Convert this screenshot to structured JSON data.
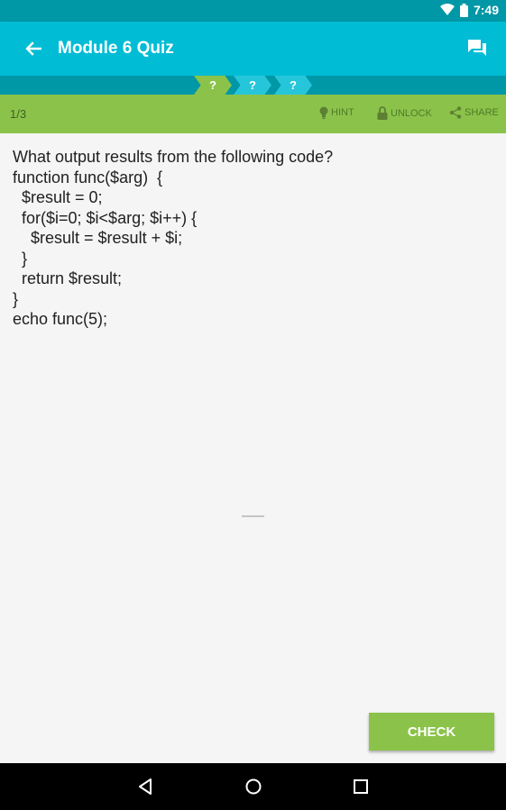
{
  "status_bar": {
    "time": "7:49",
    "icons": [
      "wifi-icon",
      "battery-icon"
    ]
  },
  "app_bar": {
    "title": "Module 6 Quiz",
    "back_icon": "arrow-back-icon",
    "chat_icon": "chat-icon"
  },
  "progress": {
    "steps": [
      "?",
      "?",
      "?"
    ],
    "active_index": 0
  },
  "quiz_bar": {
    "counter": "1/3",
    "hint_label": "HINT",
    "unlock_label": "UNLOCK",
    "share_label": "SHARE"
  },
  "question": {
    "prompt": "What output results from the following code?",
    "code_lines": [
      "function func($arg)  {",
      "  $result = 0;",
      "  for($i=0; $i<$arg; $i++) {",
      "    $result = $result + $i;",
      "  }",
      "  return $result;",
      "}",
      "echo func(5);"
    ]
  },
  "check_button": {
    "label": "CHECK"
  },
  "colors": {
    "primary": "#00bcd4",
    "primary_dark": "#0097a7",
    "accent_green": "#8bc34a",
    "step_pending": "#26c6da"
  }
}
